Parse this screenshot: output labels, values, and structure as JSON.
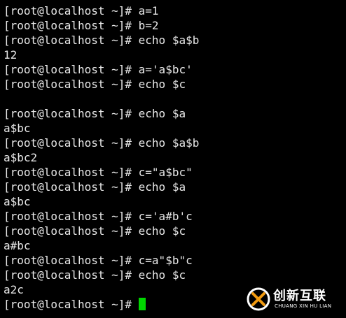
{
  "terminal": {
    "prompt": "[root@localhost ~]# ",
    "lines": [
      {
        "prompt": true,
        "text": "a=1"
      },
      {
        "prompt": true,
        "text": "b=2"
      },
      {
        "prompt": true,
        "text": "echo $a$b"
      },
      {
        "prompt": false,
        "text": "12"
      },
      {
        "prompt": true,
        "text": "a='a$bc'"
      },
      {
        "prompt": true,
        "text": "echo $c"
      },
      {
        "prompt": false,
        "text": ""
      },
      {
        "prompt": true,
        "text": "echo $a"
      },
      {
        "prompt": false,
        "text": "a$bc"
      },
      {
        "prompt": true,
        "text": "echo $a$b"
      },
      {
        "prompt": false,
        "text": "a$bc2"
      },
      {
        "prompt": true,
        "text": "c=\"a$bc\""
      },
      {
        "prompt": true,
        "text": "echo $a"
      },
      {
        "prompt": false,
        "text": "a$bc"
      },
      {
        "prompt": true,
        "text": "c='a#b'c"
      },
      {
        "prompt": true,
        "text": "echo $c"
      },
      {
        "prompt": false,
        "text": "a#bc"
      },
      {
        "prompt": true,
        "text": "c=a\"$b\"c"
      },
      {
        "prompt": true,
        "text": "echo $c"
      },
      {
        "prompt": false,
        "text": "a2c"
      },
      {
        "prompt": true,
        "text": ""
      }
    ],
    "cursor_color": "#00d700",
    "text_color": "#e8e8e8",
    "background_color": "#000000"
  },
  "watermark": {
    "logo_icon": "chuangxin-logo-icon",
    "title": "创新互联",
    "subtitle": "CHUANG XIN HU LIAN"
  }
}
